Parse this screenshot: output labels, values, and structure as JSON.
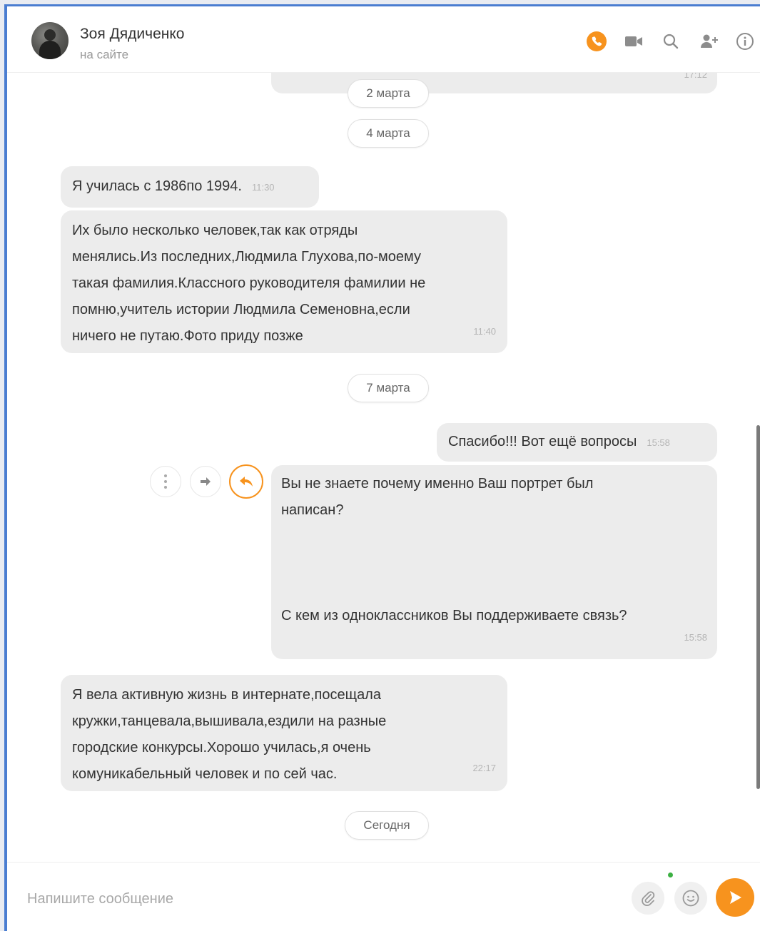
{
  "header": {
    "name": "Зоя Дядиченко",
    "status": "на сайте",
    "icons": [
      "phone-icon",
      "video-icon",
      "search-icon",
      "add-person-icon",
      "info-icon"
    ],
    "accent_color": "#f7931e"
  },
  "messages": {
    "partial_top_time": "17:12",
    "date1": "2 марта",
    "date2": "4 марта",
    "m1_text": "Я училась с 1986по 1994.",
    "m1_time": "11:30",
    "m2_lines": [
      "Их было несколько человек,так как отряды",
      "менялись.Из последних,Людмила Глухова,по-моему",
      "такая фамилия.Классного руководителя фамилии не",
      "помню,учитель истории Людмила Семеновна,если",
      "ничего не путаю.Фото приду позже"
    ],
    "m2_time": "11:40",
    "date3": "7 марта",
    "m3_text": "Спасибо!!! Вот ещё вопросы",
    "m3_time": "15:58",
    "m4_line1": "Вы не знаете почему именно Ваш портрет был",
    "m4_line2": "написан?",
    "m4_line3": "С кем из одноклассников Вы поддерживаете связь?",
    "m4_time": "15:58",
    "m5_lines": [
      "Я вела активную жизнь в интернате,посещала",
      "кружки,танцевала,вышивала,ездили на разные",
      "городские конкурсы.Хорошо училась,я очень",
      "комуникабельный человек и по сей час."
    ],
    "m5_time": "22:17",
    "date4": "Сегодня"
  },
  "composer": {
    "placeholder": "Напишите сообщение"
  }
}
